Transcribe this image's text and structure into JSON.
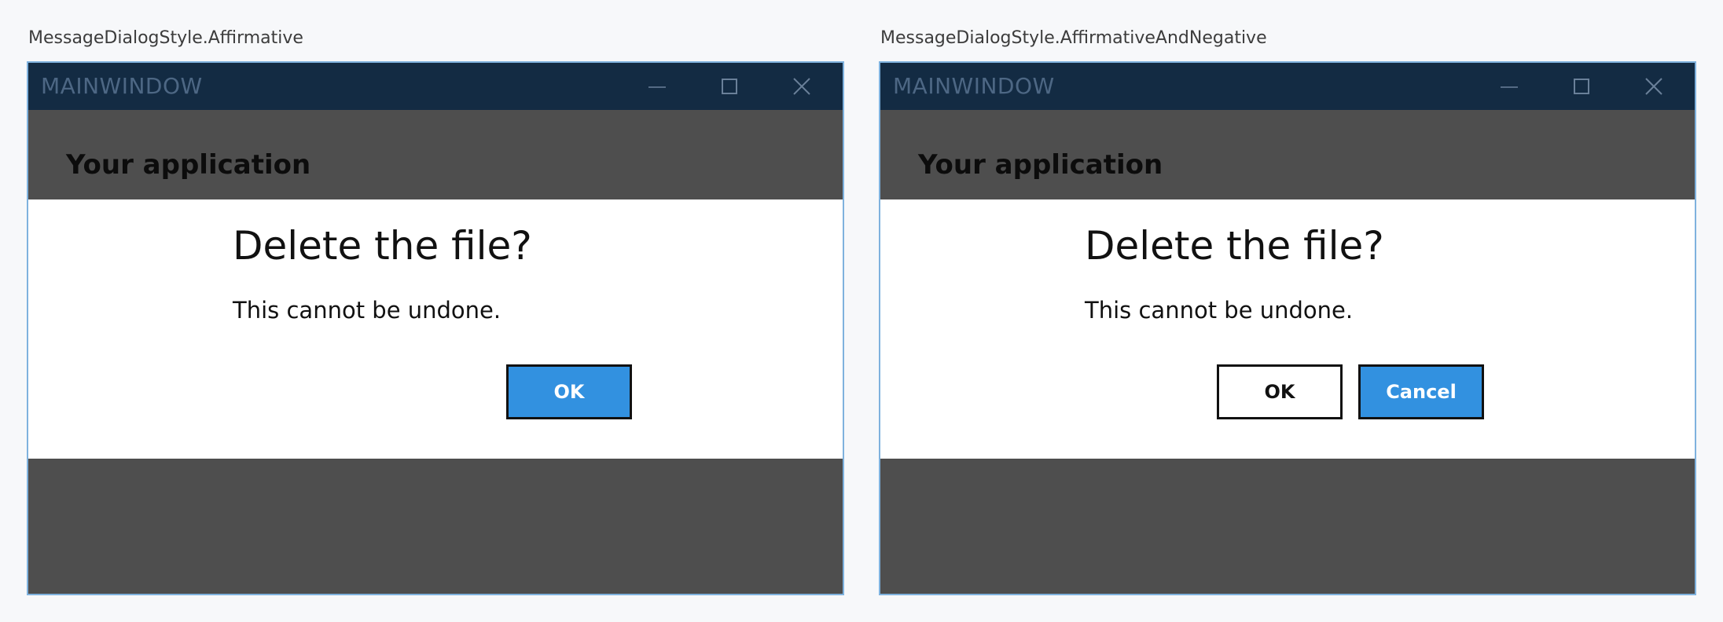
{
  "panels": [
    {
      "caption": "MessageDialogStyle.Affirmative",
      "window_title": "MAINWINDOW",
      "app_heading": "Your application",
      "dialog": {
        "title": "Delete the file?",
        "message": "This cannot be undone.",
        "ok_label": "OK"
      }
    },
    {
      "caption": "MessageDialogStyle.AffirmativeAndNegative",
      "window_title": "MAINWINDOW",
      "app_heading": "Your application",
      "dialog": {
        "title": "Delete the file?",
        "message": "This cannot be undone.",
        "ok_label": "OK",
        "cancel_label": "Cancel"
      }
    }
  ],
  "icons": {
    "minimize": "minimize-icon",
    "maximize": "maximize-icon",
    "close": "close-icon"
  },
  "colors": {
    "titlebar": "#132b43",
    "window_title_text": "#4d6784",
    "window_border": "#7fb2de",
    "overlay": "#4e4e4e",
    "dialog_bg": "#ffffff",
    "accent": "#3291e0",
    "page_bg": "#f7f8fa"
  }
}
